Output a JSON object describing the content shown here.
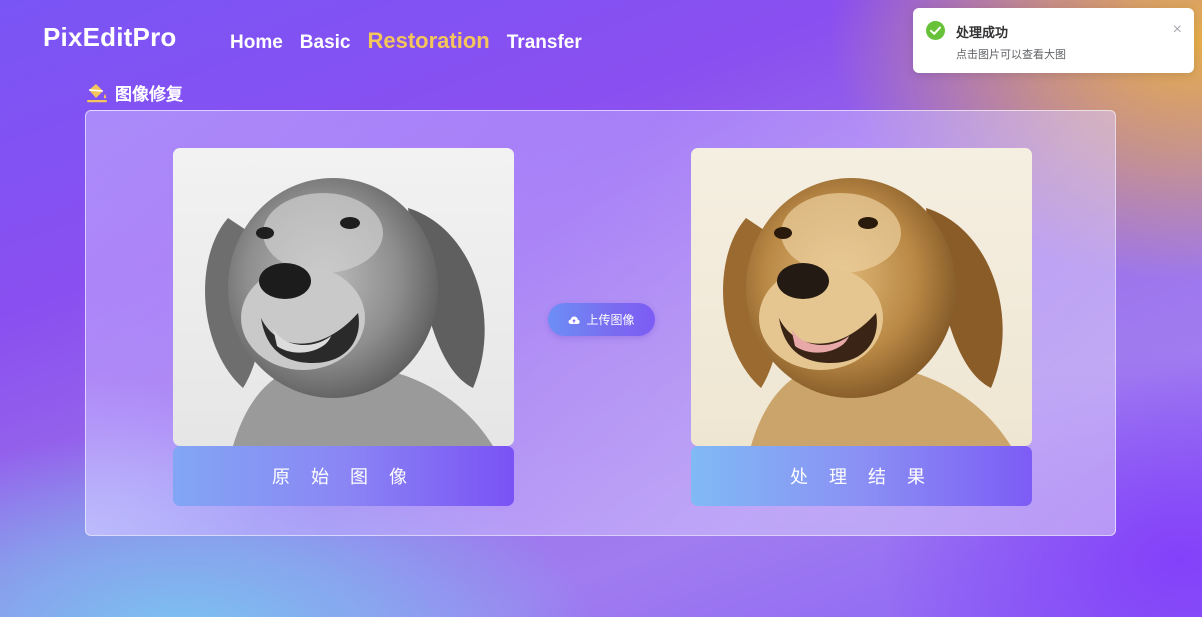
{
  "header": {
    "logo": "PixEditPro",
    "nav": [
      {
        "label": "Home",
        "active": false
      },
      {
        "label": "Basic",
        "active": false
      },
      {
        "label": "Restoration",
        "active": true
      },
      {
        "label": "Transfer",
        "active": false
      }
    ]
  },
  "section": {
    "title": "图像修复",
    "icon": "paint-bucket-icon"
  },
  "panel": {
    "original_caption": "原 始 图 像",
    "result_caption": "处 理 结 果",
    "upload_label": "上传图像",
    "upload_icon": "cloud-upload-icon"
  },
  "toast": {
    "title": "处理成功",
    "message": "点击图片可以查看大图",
    "close": "×",
    "icon": "success-check-icon"
  },
  "colors": {
    "accent_nav_active": "#f4c55a",
    "button": "#7a6cf0",
    "success": "#67c23a"
  }
}
